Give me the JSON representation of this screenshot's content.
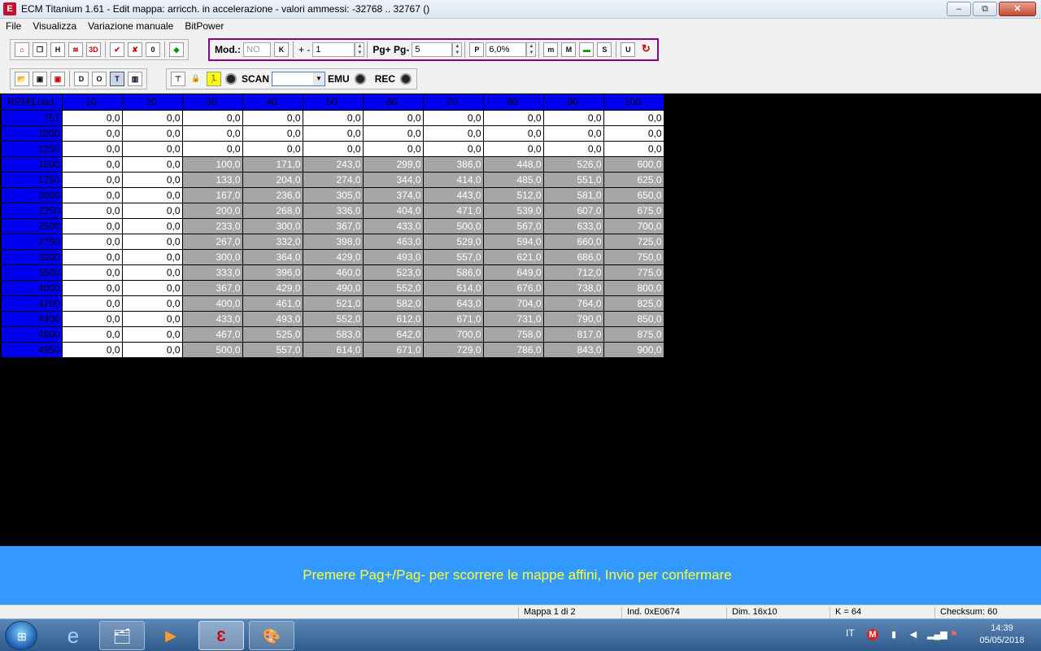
{
  "window": {
    "title": "ECM Titanium 1.61 - Edit mappa: arricch. in accelerazione - valori ammessi: -32768 .. 32767 ()",
    "icon": "app-logo-icon",
    "buttons": {
      "minimize": "–",
      "restore": "⧉",
      "close": "✕"
    }
  },
  "menu": [
    "File",
    "Visualizza",
    "Variazione manuale",
    "BitPower"
  ],
  "toolbar1": {
    "buttons_left": [
      "home-icon",
      "windows-icon",
      "h-icon",
      "chart-icon",
      "3d-icon",
      "check-icon",
      "check2-icon",
      "zero-icon",
      "color-icon"
    ],
    "mod_label": "Mod.:",
    "mod_value": "NO",
    "plusminus_label": "+ -",
    "step_value": "1",
    "pg_label": "Pg+ Pg-",
    "pg_value": "5",
    "percent_value": "6,0%"
  },
  "toolbar2": {
    "scan_label": "SCAN",
    "emu_label": "EMU",
    "rec_label": "REC"
  },
  "map_table": {
    "corner": "RPM|Load",
    "columns": [
      "10",
      "20",
      "30",
      "40",
      "50",
      "60",
      "70",
      "80",
      "90",
      "100"
    ],
    "rows": [
      {
        "rpm": "751",
        "values": [
          "0,0",
          "0,0",
          "0,0",
          "0,0",
          "0,0",
          "0,0",
          "0,0",
          "0,0",
          "0,0",
          "0,0"
        ]
      },
      {
        "rpm": "1000",
        "values": [
          "0,0",
          "0,0",
          "0,0",
          "0,0",
          "0,0",
          "0,0",
          "0,0",
          "0,0",
          "0,0",
          "0,0"
        ]
      },
      {
        "rpm": "1250",
        "values": [
          "0,0",
          "0,0",
          "0,0",
          "0,0",
          "0,0",
          "0,0",
          "0,0",
          "0,0",
          "0,0",
          "0,0"
        ]
      },
      {
        "rpm": "1500",
        "values": [
          "0,0",
          "0,0",
          "100,0",
          "171,0",
          "243,0",
          "299,0",
          "386,0",
          "448,0",
          "526,0",
          "600,0"
        ]
      },
      {
        "rpm": "1750",
        "values": [
          "0,0",
          "0,0",
          "133,0",
          "204,0",
          "274,0",
          "344,0",
          "414,0",
          "485,0",
          "551,0",
          "625,0"
        ]
      },
      {
        "rpm": "2000",
        "values": [
          "0,0",
          "0,0",
          "167,0",
          "236,0",
          "305,0",
          "374,0",
          "443,0",
          "512,0",
          "581,0",
          "650,0"
        ]
      },
      {
        "rpm": "2250",
        "values": [
          "0,0",
          "0,0",
          "200,0",
          "268,0",
          "336,0",
          "404,0",
          "471,0",
          "539,0",
          "607,0",
          "675,0"
        ]
      },
      {
        "rpm": "2500",
        "values": [
          "0,0",
          "0,0",
          "233,0",
          "300,0",
          "367,0",
          "433,0",
          "500,0",
          "567,0",
          "633,0",
          "700,0"
        ]
      },
      {
        "rpm": "2750",
        "values": [
          "0,0",
          "0,0",
          "267,0",
          "332,0",
          "398,0",
          "463,0",
          "529,0",
          "594,0",
          "660,0",
          "725,0"
        ]
      },
      {
        "rpm": "3000",
        "values": [
          "0,0",
          "0,0",
          "300,0",
          "364,0",
          "429,0",
          "493,0",
          "557,0",
          "621,0",
          "686,0",
          "750,0"
        ]
      },
      {
        "rpm": "3500",
        "values": [
          "0,0",
          "0,0",
          "333,0",
          "396,0",
          "460,0",
          "523,0",
          "586,0",
          "649,0",
          "712,0",
          "775,0"
        ]
      },
      {
        "rpm": "4000",
        "values": [
          "0,0",
          "0,0",
          "367,0",
          "429,0",
          "490,0",
          "552,0",
          "614,0",
          "676,0",
          "738,0",
          "800,0"
        ]
      },
      {
        "rpm": "4200",
        "values": [
          "0,0",
          "0,0",
          "400,0",
          "461,0",
          "521,0",
          "582,0",
          "643,0",
          "704,0",
          "764,0",
          "825,0"
        ]
      },
      {
        "rpm": "4400",
        "values": [
          "0,0",
          "0,0",
          "433,0",
          "493,0",
          "552,0",
          "612,0",
          "671,0",
          "731,0",
          "790,0",
          "850,0"
        ]
      },
      {
        "rpm": "4600",
        "values": [
          "0,0",
          "0,0",
          "467,0",
          "525,0",
          "583,0",
          "642,0",
          "700,0",
          "758,0",
          "817,0",
          "875,0"
        ]
      },
      {
        "rpm": "4950",
        "values": [
          "0,0",
          "0,0",
          "500,0",
          "557,0",
          "614,0",
          "671,0",
          "729,0",
          "786,0",
          "843,0",
          "900,0"
        ]
      }
    ]
  },
  "message": "Premere Pag+/Pag- per scorrere le mappe affini, Invio per confermare",
  "status": {
    "map": "Mappa 1 di 2",
    "ind": "Ind. 0xE0674",
    "dim": "Dim. 16x10",
    "k": "K = 64",
    "checksum": "Checksum: 60"
  },
  "taskbar": {
    "apps": [
      "ie-icon",
      "explorer-icon",
      "media-player-icon",
      "ecm-titanium-icon",
      "paint-icon"
    ],
    "lang": "IT",
    "time": "14:39",
    "date": "05/05/2018"
  },
  "colors": {
    "header_blue": "#0000f0",
    "message_bg": "#3399ff",
    "message_text": "#ffff33",
    "modified_cell": "#a6a6a6"
  }
}
